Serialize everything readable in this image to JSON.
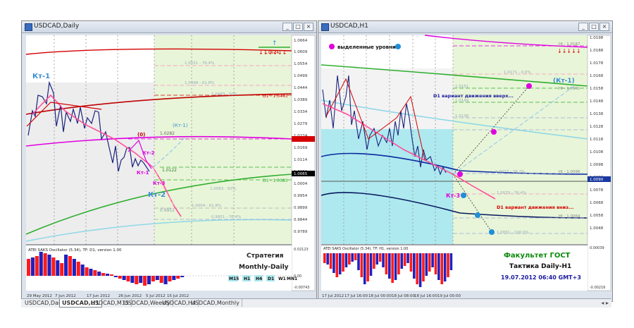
{
  "windows": {
    "left": {
      "title": "USDCAD,Daily",
      "price_labels": [
        "1.0664",
        "1.0609",
        "1.0554",
        "1.0499",
        "1.0444",
        "1.0389",
        "1.0334",
        "1.0279",
        "1.0224",
        "1.0169",
        "1.0114",
        "1.0059",
        "1.0004",
        "0.9954",
        "0.9899",
        "0.9844",
        "0.9789"
      ],
      "current_price": "1.0065",
      "kt1": "Кт-1",
      "kt2_big": "Кт-2",
      "kt2_small": "Кт-2",
      "kt1_small": "Кт-1",
      "kt3_small": "Кт-3",
      "kt1_paren": "(Кт-1)",
      "zero_label": "(0)",
      "price_tag_1": "1.0282",
      "price_tag_2": "1.0122",
      "price_tag_3": "0.9951",
      "d1_level_top": "D1 - 1.0443",
      "d1_level_bottom": "D1 - 1.0083",
      "level_texts": [
        "1.0551 - 76.4%",
        "1.0498 - 61.8%",
        "1.0449 - 50%",
        "1.0083 - 50%",
        "1.0004 - 61.8%",
        "0.9951 - 76.4%"
      ],
      "red_tag": "1.0624",
      "oscillator_title": "ATEI SAKS Oscillator (5.34), TF: D1, version 1.00",
      "osc_scale_top": "0.02123",
      "osc_scale_mid": "0.00",
      "osc_scale_bot": "-0.00743",
      "strategy_title": "Стратегия",
      "strategy_name": "Monthly-Daily",
      "timeframes": [
        "M15",
        "H1",
        "H4",
        "D1",
        "W1",
        "MN1"
      ],
      "dates": [
        "29 May 2012",
        "7 Jun 2012",
        "17 Jun 2012",
        "26 Jun 2012",
        "5 Jul 2012",
        "15 Jul 2012"
      ]
    },
    "right": {
      "title": "USDCAD,H1",
      "price_labels": [
        "1.0198",
        "1.0188",
        "1.0178",
        "1.0168",
        "1.0158",
        "1.0148",
        "1.0138",
        "1.0128",
        "1.0118",
        "1.0108",
        "1.0098",
        "1.0088",
        "1.0078",
        "1.0068",
        "1.0058",
        "1.0048"
      ],
      "current_price": "1.0090",
      "legend": "выделенные уровни",
      "kt1": "(Кт-1)",
      "kt3": "Кт-3",
      "variant_up": "D1 вариант движения вверх...",
      "variant_down": "D1 вариант движения вниз...",
      "level_texts": [
        "1.0171 - 0.0%",
        "1.0151",
        "1.0149",
        "1.0138",
        "1.0077 - 38.2%",
        "1.0079 - 76.4%",
        "1.0051 - 100.0%"
      ],
      "h1_levels": [
        "HI - 1.0187",
        "HI - 1.0161",
        "HI - 1.0096",
        "HI - 1.0064"
      ],
      "oscillator_title": "ATEI SAKS Oscillator (5.34), TF: H1, version 1.00",
      "osc_scale_top": "0.00039",
      "osc_scale_bot": "-0.00216",
      "faculty": "Факультет ГОСТ",
      "tactic": "Тактика Daily-H1",
      "datetime": "19.07.2012  06:40 GMT+3",
      "dates": [
        "17 Jul 2012",
        "17 Jul 16:00",
        "18 Jul 00:00",
        "18 Jul 08:00",
        "18 Jul 16:00",
        "19 Jul 00:00"
      ]
    }
  },
  "tabs": [
    "USDCAD,Daily",
    "USDCAD,H1",
    "USDCAD,M15",
    "USDCAD,Weekly",
    "USDCAD,H4",
    "USDCAD,Monthly"
  ],
  "active_tab": 1,
  "colors": {
    "chart_bg": "#ffffff",
    "zone_green": "#e8f5d8",
    "zone_gray": "#ececec",
    "zone_cyan": "#aee9ef",
    "candle_line": "#1a237e",
    "trend_pink": "#ff4f9a",
    "red_level": "#d50000",
    "green_level": "#2eae2e",
    "magenta": "#e000e0",
    "dotted_blue": "#1f8fd8",
    "bar_red": "#ff1a1a",
    "bar_blue": "#2020c0",
    "faculty_green": "#0a8a0a",
    "date_blue": "#1a1aa0"
  }
}
